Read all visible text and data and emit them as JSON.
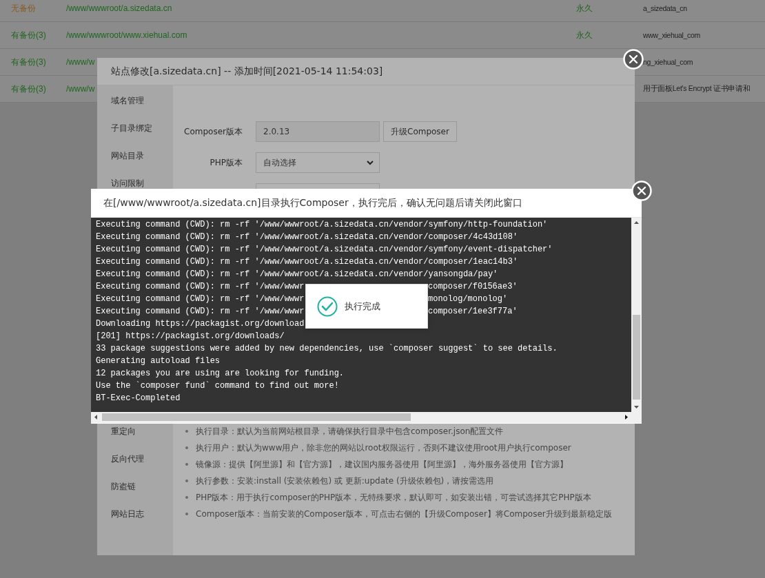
{
  "table": {
    "rows": [
      {
        "backup": "无备份",
        "has_backup": false,
        "path": "/www/wwwroot/a.sizedata.cn",
        "expiry": "永久",
        "name": "a_sizedata_cn"
      },
      {
        "backup": "有备份(3)",
        "has_backup": true,
        "path": "/www/wwwroot/www.xiehual.com",
        "expiry": "永久",
        "name": "www_xiehual_com"
      },
      {
        "backup": "有备份(3)",
        "has_backup": true,
        "path": "/www/w",
        "name": "ng_xiehual_com"
      },
      {
        "backup": "有备份(3)",
        "has_backup": true,
        "path": "/www/w",
        "name": "用于面板Let's Encrypt 证书申请和"
      }
    ]
  },
  "site_dialog": {
    "title": "站点修改[a.sizedata.cn] -- 添加时间[2021-05-14 11:54:03]",
    "sidebar": {
      "items": [
        {
          "label": "域名管理"
        },
        {
          "label": "子目录绑定"
        },
        {
          "label": "网站目录"
        },
        {
          "label": "访问限制"
        }
      ],
      "items_below": [
        {
          "label": "重定向"
        },
        {
          "label": "反向代理"
        },
        {
          "label": "防盗链"
        },
        {
          "label": "网站日志"
        }
      ]
    },
    "composer_version": {
      "label": "Composer版本",
      "value": "2.0.13",
      "button": "升级Composer"
    },
    "php_version": {
      "label": "PHP版本",
      "value": "自动选择"
    },
    "help": [
      "执行目录：默认为当前网站根目录，请确保执行目录中包含composer.json配置文件",
      "执行用户：默认为www用户，除非您的网站以root权限运行，否则不建议使用root用户执行composer",
      "镜像源：提供【阿里源】和【官方源】，建议国内服务器使用【阿里源】，海外服务器使用【官方源】",
      "执行参数：安装:install (安装依赖包) 或 更新:update (升级依赖包)，请按需选用",
      "PHP版本：用于执行composer的PHP版本，无特殊要求，默认即可，如安装出错，可尝试选择其它PHP版本",
      "Composer版本：当前安装的Composer版本，可点击右侧的【升级Composer】将Composer升级到最新稳定版"
    ]
  },
  "composer_dialog": {
    "title": "在[/www/wwwroot/a.sizedata.cn]目录执行Composer，执行完后，确认无问题后请关闭此窗口",
    "output": [
      {
        "kind": "full",
        "text": "Executing command (CWD): rm -rf '/www/wwwroot/a.sizedata.cn/vendor/symfony/http-foundation'"
      },
      {
        "kind": "full",
        "text": "Executing command (CWD): rm -rf '/www/wwwroot/a.sizedata.cn/vendor/composer/4c43d108'"
      },
      {
        "kind": "full",
        "text": "Executing command (CWD): rm -rf '/www/wwwroot/a.sizedata.cn/vendor/symfony/event-dispatcher'"
      },
      {
        "kind": "full",
        "text": "Executing command (CWD): rm -rf '/www/wwwroot/a.sizedata.cn/vendor/composer/1eac14b3'"
      },
      {
        "kind": "full",
        "text": "Executing command (CWD): rm -rf '/www/wwwroot/a.sizedata.cn/vendor/yansongda/pay'"
      },
      {
        "kind": "split",
        "text": "Executing command (CWD): rm -rf '/www/wwwr",
        "text_after": "composer/f0156ae3'"
      },
      {
        "kind": "split",
        "text": "Executing command (CWD): rm -rf '/www/wwwr",
        "text_after": "monolog/monolog'"
      },
      {
        "kind": "split",
        "text": "Executing command (CWD): rm -rf '/www/wwwr",
        "text_after": "composer/1ee3f77a'"
      },
      {
        "kind": "full",
        "text": "Downloading https://packagist.org/download"
      },
      {
        "kind": "full",
        "text": "[201] https://packagist.org/downloads/"
      },
      {
        "kind": "full",
        "text": "33 package suggestions were added by new dependencies, use `composer suggest` to see details."
      },
      {
        "kind": "full",
        "text": "Generating autoload files"
      },
      {
        "kind": "full",
        "text": "12 packages you are using are looking for funding."
      },
      {
        "kind": "full",
        "text": "Use the `composer fund` command to find out more!"
      },
      {
        "kind": "full",
        "text": "BT-Exec-Completed"
      }
    ]
  },
  "toast": {
    "message": "执行完成"
  }
}
